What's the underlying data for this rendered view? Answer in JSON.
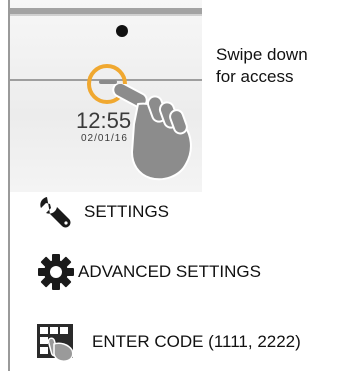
{
  "device": {
    "clock_time": "12:55 P",
    "clock_date": "02/01/16"
  },
  "instruction": {
    "line1": "Swipe down",
    "line2": "for access"
  },
  "menu": {
    "items": [
      {
        "label": "SETTINGS",
        "icon": "wrench-icon"
      },
      {
        "label": "ADVANCED SETTINGS",
        "icon": "gear-icon"
      },
      {
        "label": "ENTER CODE (1111, 2222)",
        "icon": "keypad-tap-icon"
      }
    ]
  },
  "colors": {
    "highlight_ring": "#f0a830",
    "icon_dark": "#1a1a1a",
    "hand_gray": "#8c8c8c"
  }
}
